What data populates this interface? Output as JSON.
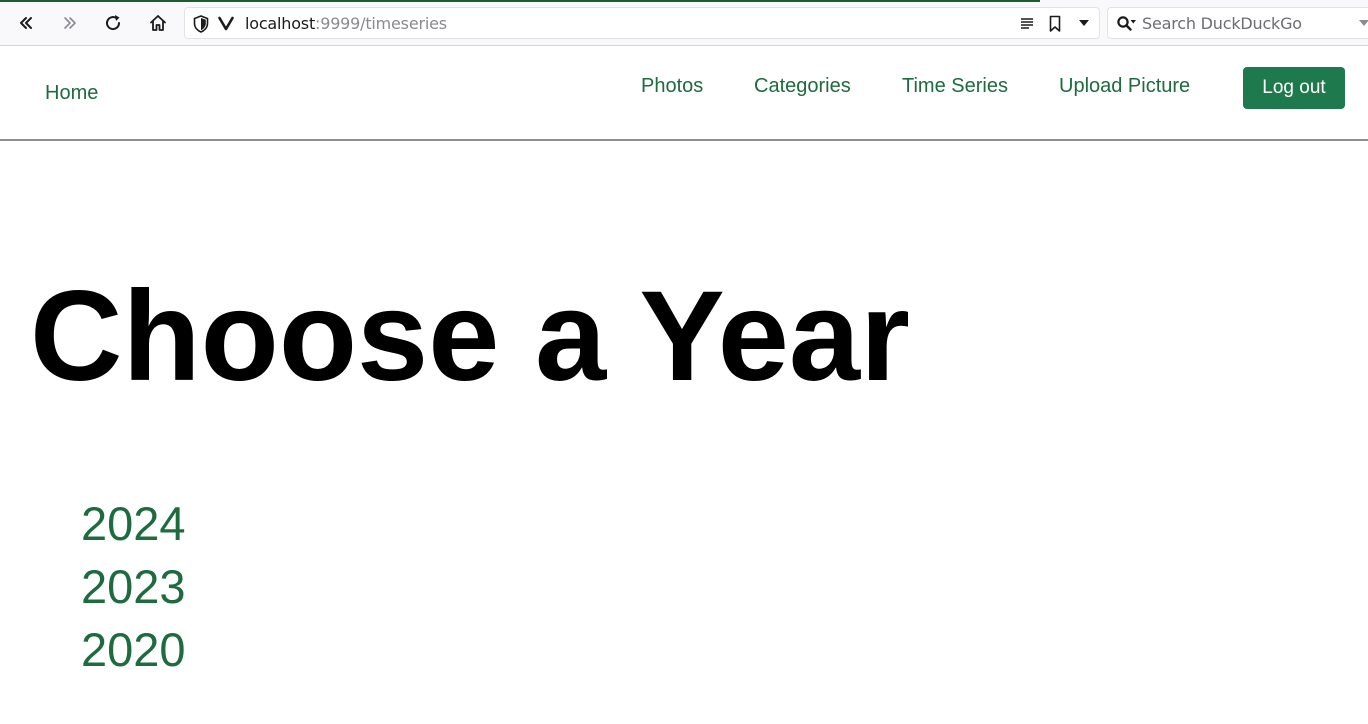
{
  "browser": {
    "url_host": "localhost",
    "url_rest": ":9999/timeseries",
    "search_placeholder": "Search DuckDuckGo",
    "icons": [
      "back-all-icon",
      "forward-all-icon",
      "reload-icon",
      "home-icon",
      "shield-icon",
      "vivaldi-icon",
      "reader-icon",
      "bookmark-icon",
      "dropdown-icon",
      "search-icon"
    ]
  },
  "header": {
    "home": "Home",
    "nav": [
      "Photos",
      "Categories",
      "Time Series",
      "Upload Picture"
    ],
    "logout": "Log out"
  },
  "main": {
    "title": "Choose a Year",
    "years": [
      "2024",
      "2023",
      "2020"
    ]
  },
  "colors": {
    "link": "#1d6b3e",
    "button_bg": "#1e7a4c",
    "button_text": "#ffffff"
  }
}
